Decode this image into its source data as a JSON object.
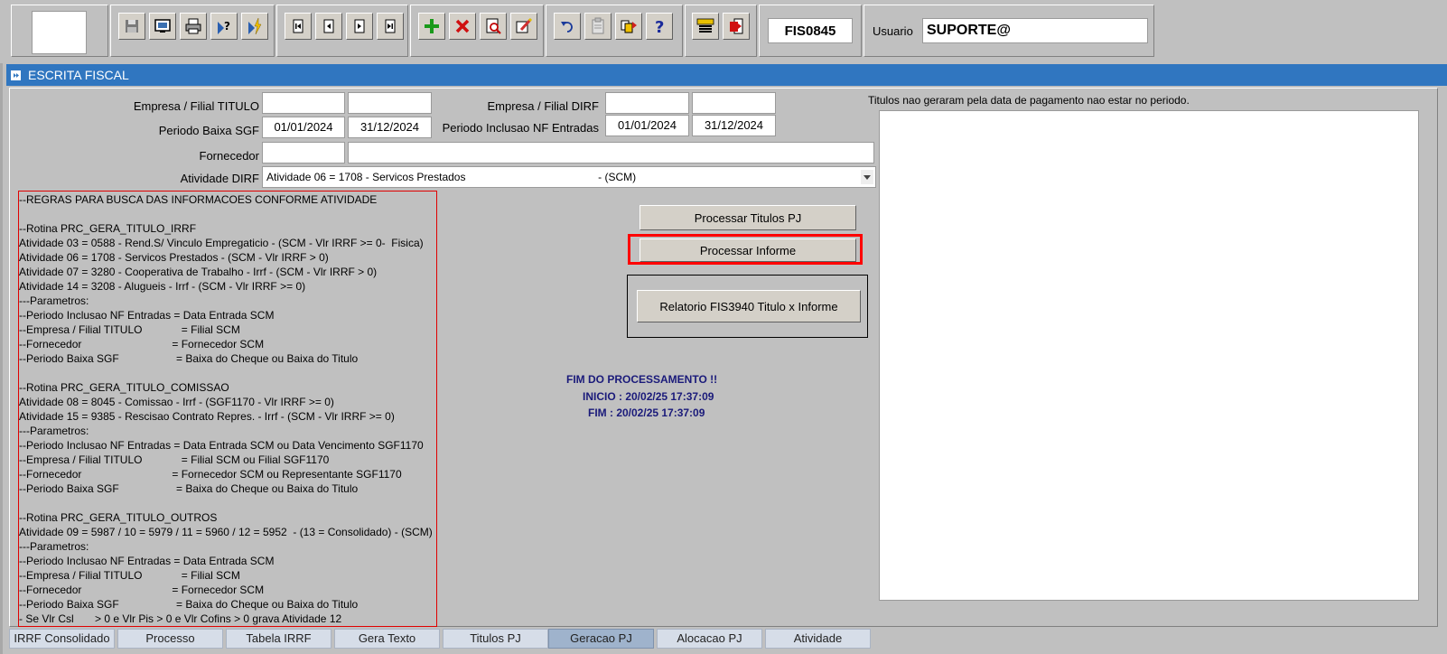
{
  "toolbar": {
    "form_code": "FIS0845",
    "usuario_label": "Usuario",
    "usuario_value": "SUPORTE@",
    "icons": [
      "save-icon",
      "screen-icon",
      "print-icon",
      "query-icon",
      "execute-icon",
      "first-record-icon",
      "previous-record-icon",
      "next-record-icon",
      "last-record-icon",
      "insert-record-icon",
      "delete-record-icon",
      "search-record-icon",
      "edit-record-icon",
      "undo-icon",
      "clipboard-icon",
      "duplicate-icon",
      "help-icon",
      "menu-icon",
      "exit-icon"
    ]
  },
  "window": {
    "title": "ESCRITA FISCAL"
  },
  "form": {
    "empresa_titulo_label": "Empresa / Filial TITULO",
    "empresa_dirf_label": "Empresa / Filial  DIRF",
    "periodo_baixa_label": "Periodo Baixa SGF",
    "periodo_baixa_ini": "01/01/2024",
    "periodo_baixa_fim": "31/12/2024",
    "periodo_inclusao_label": "Periodo Inclusao NF Entradas",
    "periodo_inclusao_ini": "01/01/2024",
    "periodo_inclusao_fim": "31/12/2024",
    "fornecedor_label": "Fornecedor",
    "atividade_label": "Atividade DIRF",
    "atividade_value": "Atividade 06 = 1708 - Servicos Prestados                                            - (SCM)"
  },
  "rules": [
    "--REGRAS PARA BUSCA DAS INFORMACOES CONFORME ATIVIDADE",
    "",
    "--Rotina PRC_GERA_TITULO_IRRF",
    "Atividade 03 = 0588 - Rend.S/ Vinculo Empregaticio - (SCM - Vlr IRRF >= 0-  Fisica)",
    "Atividade 06 = 1708 - Servicos Prestados - (SCM - Vlr IRRF > 0)",
    "Atividade 07 = 3280 - Cooperativa de Trabalho - Irrf - (SCM - Vlr IRRF > 0)",
    "Atividade 14 = 3208 - Alugueis - Irrf - (SCM - Vlr IRRF >= 0)",
    "---Parametros:",
    "--Periodo Inclusao NF Entradas = Data Entrada SCM",
    "--Empresa / Filial TITULO             = Filial SCM",
    "--Fornecedor                              = Fornecedor SCM",
    "--Periodo Baixa SGF                   = Baixa do Cheque ou Baixa do Titulo",
    "",
    "--Rotina PRC_GERA_TITULO_COMISSAO",
    "Atividade 08 = 8045 - Comissao - Irrf - (SGF1170 - Vlr IRRF >= 0)",
    "Atividade 15 = 9385 - Rescisao Contrato Repres. - Irrf - (SCM - Vlr IRRF >= 0)",
    "---Parametros:",
    "--Periodo Inclusao NF Entradas = Data Entrada SCM ou Data Vencimento SGF1170",
    "--Empresa / Filial TITULO             = Filial SCM ou Filial SGF1170",
    "--Fornecedor                              = Fornecedor SCM ou Representante SGF1170",
    "--Periodo Baixa SGF                   = Baixa do Cheque ou Baixa do Titulo",
    "",
    "--Rotina PRC_GERA_TITULO_OUTROS",
    "Atividade 09 = 5987 / 10 = 5979 / 11 = 5960 / 12 = 5952  - (13 = Consolidado) - (SCM)",
    "---Parametros:",
    "--Periodo Inclusao NF Entradas = Data Entrada SCM",
    "--Empresa / Filial TITULO             = Filial SCM",
    "--Fornecedor                              = Fornecedor SCM",
    "--Periodo Baixa SGF                   = Baixa do Cheque ou Baixa do Titulo",
    "- Se Vlr Csl       > 0 e Vlr Pis > 0 e Vlr Cofins > 0 grava Atividade 12"
  ],
  "buttons": {
    "processar_titulos": "Processar Titulos PJ",
    "processar_informe": "Processar Informe",
    "relatorio": "Relatorio FIS3940 Titulo x Informe"
  },
  "status": {
    "fim_processamento": "FIM DO  PROCESSAMENTO !!",
    "inicio": "INICIO : 20/02/25 17:37:09",
    "fim": "FIM : 20/02/25 17:37:09"
  },
  "right_panel": {
    "label": "Titulos nao geraram pela data de pagamento nao estar no periodo."
  },
  "tabs": [
    {
      "label": "IRRF Consolidado",
      "active": false
    },
    {
      "label": "Processo",
      "active": false
    },
    {
      "label": "Tabela IRRF",
      "active": false
    },
    {
      "label": "Gera Texto",
      "active": false
    },
    {
      "label": "Titulos PJ",
      "active": false
    },
    {
      "label": "Geracao PJ",
      "active": true
    },
    {
      "label": "Alocacao PJ",
      "active": false
    },
    {
      "label": "Atividade",
      "active": false
    }
  ]
}
